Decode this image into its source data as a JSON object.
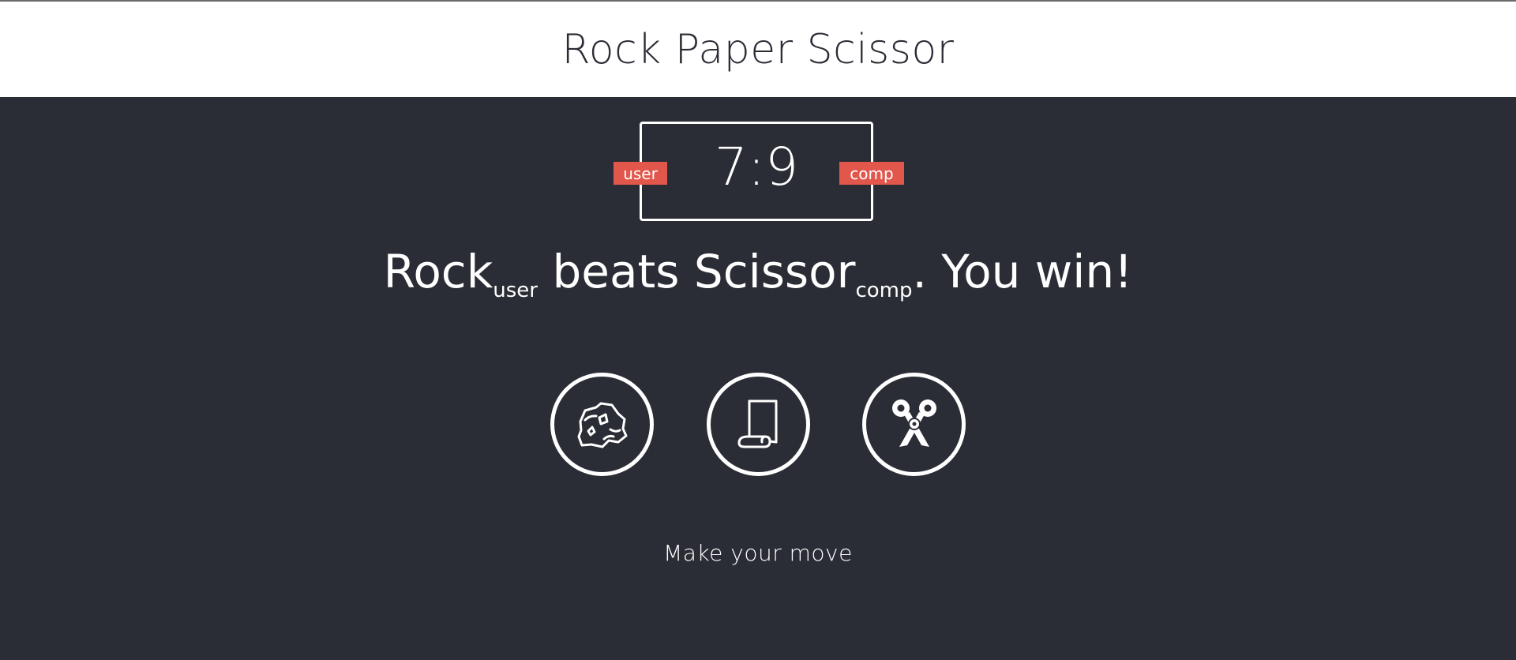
{
  "header": {
    "title": "Rock Paper Scissor"
  },
  "scoreboard": {
    "user_label": "user",
    "comp_label": "comp",
    "score": "7:9"
  },
  "result": {
    "user_choice": "Rock",
    "user_sub": "user",
    "verb": "beats",
    "comp_choice": "Scissor",
    "comp_sub": "comp",
    "outcome": ". You win!"
  },
  "choices": [
    {
      "name": "rock",
      "icon": "rock-icon"
    },
    {
      "name": "paper",
      "icon": "paper-scroll-icon"
    },
    {
      "name": "scissors",
      "icon": "scissors-icon"
    }
  ],
  "message": "Make your move",
  "colors": {
    "background": "#2b2d36",
    "header_background": "#ffffff",
    "badge": "#e2574c",
    "text_light": "#ffffff",
    "text_dark": "#2b2d36"
  }
}
